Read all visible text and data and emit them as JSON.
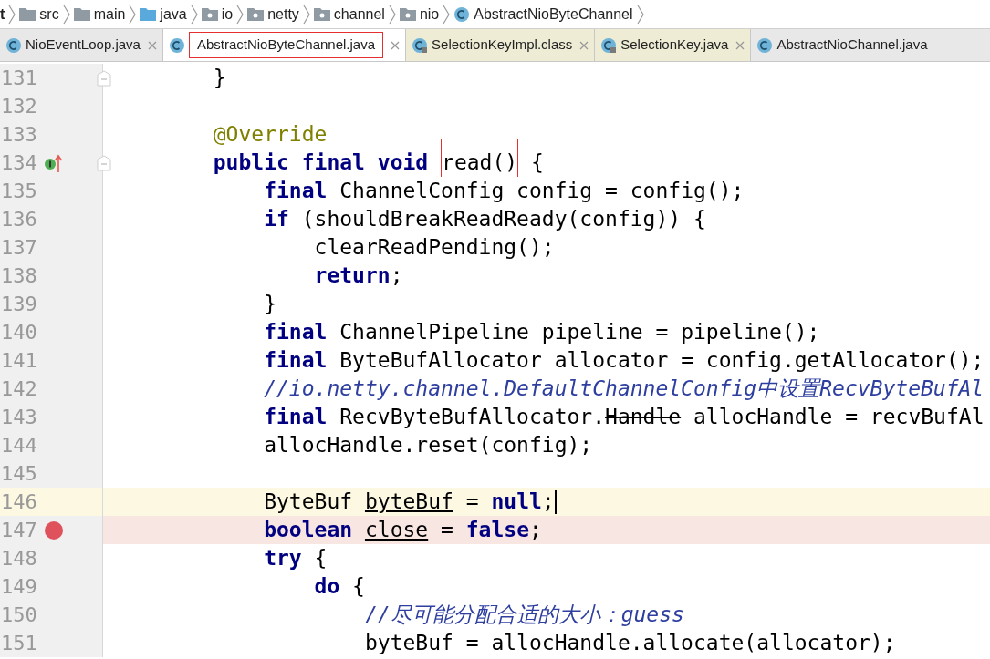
{
  "breadcrumb": [
    {
      "label": "t",
      "kind": "project"
    },
    {
      "label": "src",
      "kind": "folder"
    },
    {
      "label": "main",
      "kind": "folder"
    },
    {
      "label": "java",
      "kind": "source"
    },
    {
      "label": "io",
      "kind": "package"
    },
    {
      "label": "netty",
      "kind": "package"
    },
    {
      "label": "channel",
      "kind": "package"
    },
    {
      "label": "nio",
      "kind": "package"
    },
    {
      "label": "AbstractNioByteChannel",
      "kind": "class"
    }
  ],
  "tabs": [
    {
      "label": "NioEventLoop.java",
      "selected": false,
      "library": false,
      "closable": true,
      "highlighted": false
    },
    {
      "label": "AbstractNioByteChannel.java",
      "selected": true,
      "library": false,
      "closable": true,
      "highlighted": true
    },
    {
      "label": "SelectionKeyImpl.class",
      "selected": false,
      "library": true,
      "closable": true,
      "highlighted": false
    },
    {
      "label": "SelectionKey.java",
      "selected": false,
      "library": true,
      "closable": true,
      "highlighted": false
    },
    {
      "label": "AbstractNioChannel.java",
      "selected": false,
      "library": false,
      "closable": false,
      "highlighted": false
    }
  ],
  "editor": {
    "lines": [
      {
        "number": "131",
        "current": false,
        "breakpoint": false,
        "fold": true,
        "tokens": [
          {
            "text": "        }",
            "kind": "plain"
          }
        ]
      },
      {
        "number": "132",
        "current": false,
        "breakpoint": false
      },
      {
        "number": "133",
        "current": false,
        "breakpoint": false,
        "tokens": [
          {
            "text": "        @Override",
            "kind": "annotation"
          }
        ]
      },
      {
        "number": "134",
        "current": false,
        "breakpoint": false,
        "fold": true,
        "override_marker": true,
        "tokens": [
          {
            "text": "        public final void ",
            "kind": "keyword"
          },
          {
            "text": "read()",
            "kind": "boxed"
          },
          {
            "text": " {",
            "kind": "plain"
          }
        ]
      },
      {
        "number": "135",
        "current": false,
        "breakpoint": false,
        "tokens": [
          {
            "text": "            final",
            "kind": "keyword"
          },
          {
            "text": " ChannelConfig config = config();",
            "kind": "plain"
          }
        ]
      },
      {
        "number": "136",
        "current": false,
        "breakpoint": false,
        "tokens": [
          {
            "text": "            if",
            "kind": "keyword"
          },
          {
            "text": " (shouldBreakReadReady(config)) {",
            "kind": "plain"
          }
        ]
      },
      {
        "number": "137",
        "current": false,
        "breakpoint": false,
        "tokens": [
          {
            "text": "                clearReadPending();",
            "kind": "plain"
          }
        ]
      },
      {
        "number": "138",
        "current": false,
        "breakpoint": false,
        "tokens": [
          {
            "text": "                return",
            "kind": "keyword"
          },
          {
            "text": ";",
            "kind": "plain"
          }
        ]
      },
      {
        "number": "139",
        "current": false,
        "breakpoint": false,
        "tokens": [
          {
            "text": "            }",
            "kind": "plain"
          }
        ]
      },
      {
        "number": "140",
        "current": false,
        "breakpoint": false,
        "tokens": [
          {
            "text": "            final",
            "kind": "keyword"
          },
          {
            "text": " ChannelPipeline pipeline = pipeline();",
            "kind": "plain"
          }
        ]
      },
      {
        "number": "141",
        "current": false,
        "breakpoint": false,
        "tokens": [
          {
            "text": "            final",
            "kind": "keyword"
          },
          {
            "text": " ByteBufAllocator allocator = config.getAllocator();",
            "kind": "plain"
          }
        ]
      },
      {
        "number": "142",
        "current": false,
        "breakpoint": false,
        "tokens": [
          {
            "text": "            //io.netty.channel.DefaultChannelConfig中设置RecvByteBufAl",
            "kind": "comment"
          }
        ]
      },
      {
        "number": "143",
        "current": false,
        "breakpoint": false,
        "tokens": [
          {
            "text": "            final",
            "kind": "keyword"
          },
          {
            "text": " RecvByteBufAllocator.",
            "kind": "plain"
          },
          {
            "text": "Handle",
            "kind": "deprecated"
          },
          {
            "text": " allocHandle = recvBufAl",
            "kind": "plain"
          }
        ]
      },
      {
        "number": "144",
        "current": false,
        "breakpoint": false,
        "tokens": [
          {
            "text": "            allocHandle.reset(config);",
            "kind": "plain"
          }
        ]
      },
      {
        "number": "145",
        "current": false,
        "breakpoint": false
      },
      {
        "number": "146",
        "current": true,
        "breakpoint": false,
        "caret": true,
        "tokens": [
          {
            "text": "            ByteBuf ",
            "kind": "plain"
          },
          {
            "text": "byteBuf",
            "kind": "underlined"
          },
          {
            "text": " = ",
            "kind": "plain"
          },
          {
            "text": "null",
            "kind": "keyword"
          },
          {
            "text": ";",
            "kind": "plain"
          }
        ]
      },
      {
        "number": "147",
        "current": false,
        "breakpoint": true,
        "tokens": [
          {
            "text": "            boolean ",
            "kind": "keyword"
          },
          {
            "text": "close",
            "kind": "underlined"
          },
          {
            "text": " = ",
            "kind": "plain"
          },
          {
            "text": "false",
            "kind": "keyword"
          },
          {
            "text": ";",
            "kind": "plain"
          }
        ]
      },
      {
        "number": "148",
        "current": false,
        "breakpoint": false,
        "tokens": [
          {
            "text": "            try",
            "kind": "keyword"
          },
          {
            "text": " {",
            "kind": "plain"
          }
        ]
      },
      {
        "number": "149",
        "current": false,
        "breakpoint": false,
        "tokens": [
          {
            "text": "                do",
            "kind": "keyword"
          },
          {
            "text": " {",
            "kind": "plain"
          }
        ]
      },
      {
        "number": "150",
        "current": false,
        "breakpoint": false,
        "tokens": [
          {
            "text": "                    //尽可能分配合适的大小：guess",
            "kind": "comment"
          }
        ]
      },
      {
        "number": "151",
        "current": false,
        "breakpoint": false,
        "tokens": [
          {
            "text": "                    byteBuf = allocHandle.allocate(allocator);",
            "kind": "plain"
          }
        ]
      }
    ]
  }
}
